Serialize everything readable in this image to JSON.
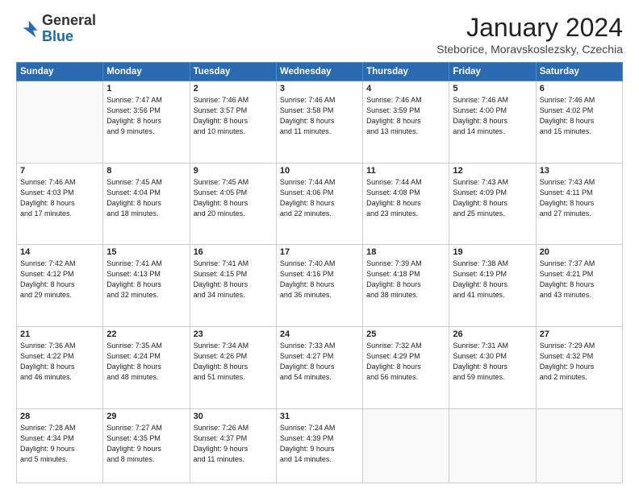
{
  "logo": {
    "general": "General",
    "blue": "Blue"
  },
  "calendar": {
    "title": "January 2024",
    "subtitle": "Steborice, Moravskoslezsky, Czechia"
  },
  "weekdays": [
    "Sunday",
    "Monday",
    "Tuesday",
    "Wednesday",
    "Thursday",
    "Friday",
    "Saturday"
  ],
  "weeks": [
    [
      {
        "day": "",
        "info": ""
      },
      {
        "day": "1",
        "info": "Sunrise: 7:47 AM\nSunset: 3:56 PM\nDaylight: 8 hours\nand 9 minutes."
      },
      {
        "day": "2",
        "info": "Sunrise: 7:46 AM\nSunset: 3:57 PM\nDaylight: 8 hours\nand 10 minutes."
      },
      {
        "day": "3",
        "info": "Sunrise: 7:46 AM\nSunset: 3:58 PM\nDaylight: 8 hours\nand 11 minutes."
      },
      {
        "day": "4",
        "info": "Sunrise: 7:46 AM\nSunset: 3:59 PM\nDaylight: 8 hours\nand 13 minutes."
      },
      {
        "day": "5",
        "info": "Sunrise: 7:46 AM\nSunset: 4:00 PM\nDaylight: 8 hours\nand 14 minutes."
      },
      {
        "day": "6",
        "info": "Sunrise: 7:46 AM\nSunset: 4:02 PM\nDaylight: 8 hours\nand 15 minutes."
      }
    ],
    [
      {
        "day": "7",
        "info": "Sunrise: 7:46 AM\nSunset: 4:03 PM\nDaylight: 8 hours\nand 17 minutes."
      },
      {
        "day": "8",
        "info": "Sunrise: 7:45 AM\nSunset: 4:04 PM\nDaylight: 8 hours\nand 18 minutes."
      },
      {
        "day": "9",
        "info": "Sunrise: 7:45 AM\nSunset: 4:05 PM\nDaylight: 8 hours\nand 20 minutes."
      },
      {
        "day": "10",
        "info": "Sunrise: 7:44 AM\nSunset: 4:06 PM\nDaylight: 8 hours\nand 22 minutes."
      },
      {
        "day": "11",
        "info": "Sunrise: 7:44 AM\nSunset: 4:08 PM\nDaylight: 8 hours\nand 23 minutes."
      },
      {
        "day": "12",
        "info": "Sunrise: 7:43 AM\nSunset: 4:09 PM\nDaylight: 8 hours\nand 25 minutes."
      },
      {
        "day": "13",
        "info": "Sunrise: 7:43 AM\nSunset: 4:11 PM\nDaylight: 8 hours\nand 27 minutes."
      }
    ],
    [
      {
        "day": "14",
        "info": "Sunrise: 7:42 AM\nSunset: 4:12 PM\nDaylight: 8 hours\nand 29 minutes."
      },
      {
        "day": "15",
        "info": "Sunrise: 7:41 AM\nSunset: 4:13 PM\nDaylight: 8 hours\nand 32 minutes."
      },
      {
        "day": "16",
        "info": "Sunrise: 7:41 AM\nSunset: 4:15 PM\nDaylight: 8 hours\nand 34 minutes."
      },
      {
        "day": "17",
        "info": "Sunrise: 7:40 AM\nSunset: 4:16 PM\nDaylight: 8 hours\nand 36 minutes."
      },
      {
        "day": "18",
        "info": "Sunrise: 7:39 AM\nSunset: 4:18 PM\nDaylight: 8 hours\nand 38 minutes."
      },
      {
        "day": "19",
        "info": "Sunrise: 7:38 AM\nSunset: 4:19 PM\nDaylight: 8 hours\nand 41 minutes."
      },
      {
        "day": "20",
        "info": "Sunrise: 7:37 AM\nSunset: 4:21 PM\nDaylight: 8 hours\nand 43 minutes."
      }
    ],
    [
      {
        "day": "21",
        "info": "Sunrise: 7:36 AM\nSunset: 4:22 PM\nDaylight: 8 hours\nand 46 minutes."
      },
      {
        "day": "22",
        "info": "Sunrise: 7:35 AM\nSunset: 4:24 PM\nDaylight: 8 hours\nand 48 minutes."
      },
      {
        "day": "23",
        "info": "Sunrise: 7:34 AM\nSunset: 4:26 PM\nDaylight: 8 hours\nand 51 minutes."
      },
      {
        "day": "24",
        "info": "Sunrise: 7:33 AM\nSunset: 4:27 PM\nDaylight: 8 hours\nand 54 minutes."
      },
      {
        "day": "25",
        "info": "Sunrise: 7:32 AM\nSunset: 4:29 PM\nDaylight: 8 hours\nand 56 minutes."
      },
      {
        "day": "26",
        "info": "Sunrise: 7:31 AM\nSunset: 4:30 PM\nDaylight: 8 hours\nand 59 minutes."
      },
      {
        "day": "27",
        "info": "Sunrise: 7:29 AM\nSunset: 4:32 PM\nDaylight: 9 hours\nand 2 minutes."
      }
    ],
    [
      {
        "day": "28",
        "info": "Sunrise: 7:28 AM\nSunset: 4:34 PM\nDaylight: 9 hours\nand 5 minutes."
      },
      {
        "day": "29",
        "info": "Sunrise: 7:27 AM\nSunset: 4:35 PM\nDaylight: 9 hours\nand 8 minutes."
      },
      {
        "day": "30",
        "info": "Sunrise: 7:26 AM\nSunset: 4:37 PM\nDaylight: 9 hours\nand 11 minutes."
      },
      {
        "day": "31",
        "info": "Sunrise: 7:24 AM\nSunset: 4:39 PM\nDaylight: 9 hours\nand 14 minutes."
      },
      {
        "day": "",
        "info": ""
      },
      {
        "day": "",
        "info": ""
      },
      {
        "day": "",
        "info": ""
      }
    ]
  ]
}
